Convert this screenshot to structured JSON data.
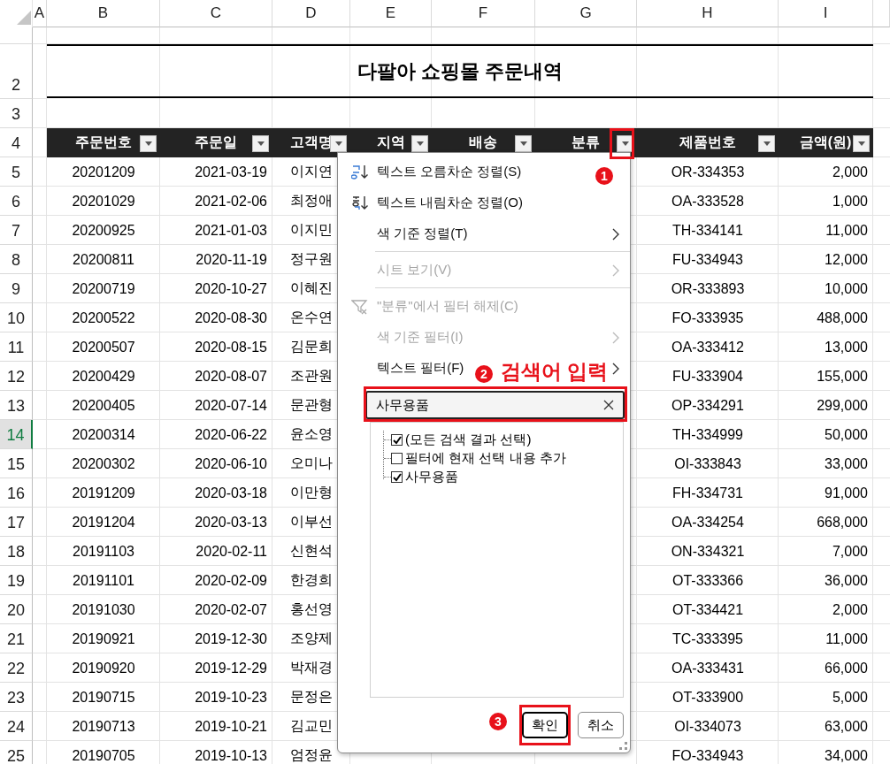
{
  "column_headers": [
    "A",
    "B",
    "C",
    "D",
    "E",
    "F",
    "G",
    "H",
    "I"
  ],
  "row_headers": [
    {
      "number": "2",
      "selected": false
    },
    {
      "number": "3",
      "selected": false
    },
    {
      "number": "4",
      "selected": false
    },
    {
      "number": "5",
      "selected": false
    },
    {
      "number": "6",
      "selected": false
    },
    {
      "number": "7",
      "selected": false
    },
    {
      "number": "8",
      "selected": false
    },
    {
      "number": "9",
      "selected": false
    },
    {
      "number": "10",
      "selected": false
    },
    {
      "number": "11",
      "selected": false
    },
    {
      "number": "12",
      "selected": false
    },
    {
      "number": "13",
      "selected": false
    },
    {
      "number": "14",
      "selected": true
    },
    {
      "number": "15",
      "selected": false
    },
    {
      "number": "16",
      "selected": false
    },
    {
      "number": "17",
      "selected": false
    },
    {
      "number": "18",
      "selected": false
    },
    {
      "number": "19",
      "selected": false
    },
    {
      "number": "20",
      "selected": false
    },
    {
      "number": "21",
      "selected": false
    },
    {
      "number": "22",
      "selected": false
    },
    {
      "number": "23",
      "selected": false
    },
    {
      "number": "24",
      "selected": false
    },
    {
      "number": "25",
      "selected": false
    }
  ],
  "title": "다팔아 쇼핑몰 주문내역",
  "table": {
    "columns": [
      "주문번호",
      "주문일",
      "고객명",
      "지역",
      "배송",
      "분류",
      "제품번호",
      "금액(원)"
    ],
    "rows": [
      [
        "20201209",
        "2021-03-19",
        "이지연",
        "OR-334353",
        "2,000"
      ],
      [
        "20201029",
        "2021-02-06",
        "최정애",
        "OA-333528",
        "1,000"
      ],
      [
        "20200925",
        "2021-01-03",
        "이지민",
        "TH-334141",
        "11,000"
      ],
      [
        "20200811",
        "2020-11-19",
        "정구원",
        "FU-334943",
        "12,000"
      ],
      [
        "20200719",
        "2020-10-27",
        "이혜진",
        "OR-333893",
        "10,000"
      ],
      [
        "20200522",
        "2020-08-30",
        "온수연",
        "FO-333935",
        "488,000"
      ],
      [
        "20200507",
        "2020-08-15",
        "김문희",
        "OA-333412",
        "13,000"
      ],
      [
        "20200429",
        "2020-08-07",
        "조관원",
        "FU-333904",
        "155,000"
      ],
      [
        "20200405",
        "2020-07-14",
        "문관형",
        "OP-334291",
        "299,000"
      ],
      [
        "20200314",
        "2020-06-22",
        "윤소영",
        "TH-334999",
        "50,000"
      ],
      [
        "20200302",
        "2020-06-10",
        "오미나",
        "OI-333843",
        "33,000"
      ],
      [
        "20191209",
        "2020-03-18",
        "이만형",
        "FH-334731",
        "91,000"
      ],
      [
        "20191204",
        "2020-03-13",
        "이부선",
        "OA-334254",
        "668,000"
      ],
      [
        "20191103",
        "2020-02-11",
        "신현석",
        "ON-334321",
        "7,000"
      ],
      [
        "20191101",
        "2020-02-09",
        "한경희",
        "OT-333366",
        "36,000"
      ],
      [
        "20191030",
        "2020-02-07",
        "홍선영",
        "OT-334421",
        "2,000"
      ],
      [
        "20190921",
        "2019-12-30",
        "조양제",
        "TC-333395",
        "11,000"
      ],
      [
        "20190920",
        "2019-12-29",
        "박재경",
        "OA-333431",
        "66,000"
      ],
      [
        "20190715",
        "2019-10-23",
        "문정은",
        "OT-333900",
        "5,000"
      ],
      [
        "20190713",
        "2019-10-21",
        "김교민",
        "OI-334073",
        "63,000"
      ],
      [
        "20190705",
        "2019-10-13",
        "엄정윤",
        "FO-334943",
        "34,000"
      ]
    ]
  },
  "filter_menu": {
    "items": [
      {
        "kind": "sort_asc",
        "label": "텍스트 오름차순 정렬(S)",
        "disabled": false
      },
      {
        "kind": "sort_desc",
        "label": "텍스트 내림차순 정렬(O)",
        "disabled": false
      },
      {
        "kind": "submenu",
        "label": "색 기준 정렬(T)",
        "disabled": false
      },
      {
        "kind": "separator"
      },
      {
        "kind": "submenu",
        "label": "시트 보기(V)",
        "disabled": true
      },
      {
        "kind": "separator"
      },
      {
        "kind": "clear_filter",
        "label": "\"분류\"에서 필터 해제(C)",
        "disabled": true
      },
      {
        "kind": "submenu",
        "label": "색 기준 필터(I)",
        "disabled": true
      },
      {
        "kind": "submenu",
        "label": "텍스트 필터(F)",
        "disabled": false
      }
    ],
    "search": {
      "value": "사무용품"
    },
    "list": [
      {
        "label": "(모든 검색 결과 선택)",
        "checked": true
      },
      {
        "label": "필터에 현재 선택 내용 추가",
        "checked": false
      },
      {
        "label": "사무용품",
        "checked": true
      }
    ],
    "buttons": [
      {
        "label": "확인",
        "default": true
      },
      {
        "label": "취소",
        "default": false
      }
    ]
  },
  "annotations": [
    {
      "kind": "filter_button",
      "number": "1"
    },
    {
      "kind": "search_field",
      "number": "2",
      "text": "검색어 입력"
    },
    {
      "kind": "ok_button",
      "number": "3"
    }
  ]
}
